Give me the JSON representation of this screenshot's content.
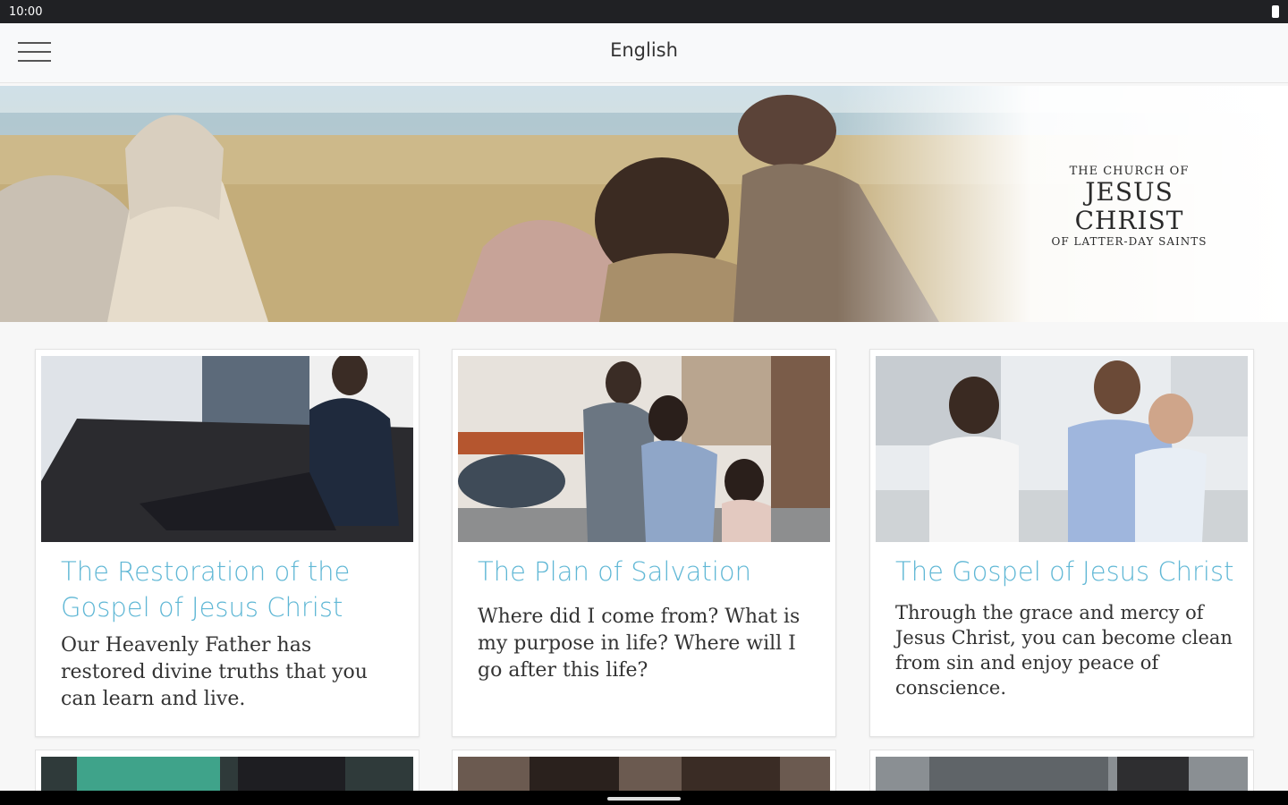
{
  "status": {
    "time": "10:00"
  },
  "app_bar": {
    "title": "English"
  },
  "hero": {
    "logo_top": "THE CHURCH OF",
    "logo_main": "JESUS CHRIST",
    "logo_bottom": "OF LATTER-DAY SAINTS"
  },
  "cards": [
    {
      "title": "The Restoration of the Gospel of Jesus Christ",
      "description": "Our Heavenly Father has restored divine truths that you can learn and live."
    },
    {
      "title": "The Plan of Salvation",
      "description": "Where did I come from? What is my purpose in life? Where will I go after this life?"
    },
    {
      "title": "The Gospel of Jesus Christ",
      "description": "Through the grace and mercy of Jesus Christ, you can become clean from sin and enjoy peace of conscience."
    }
  ],
  "colors": {
    "accent": "#5fb7d5",
    "app_bar": "#f8f9fa"
  }
}
